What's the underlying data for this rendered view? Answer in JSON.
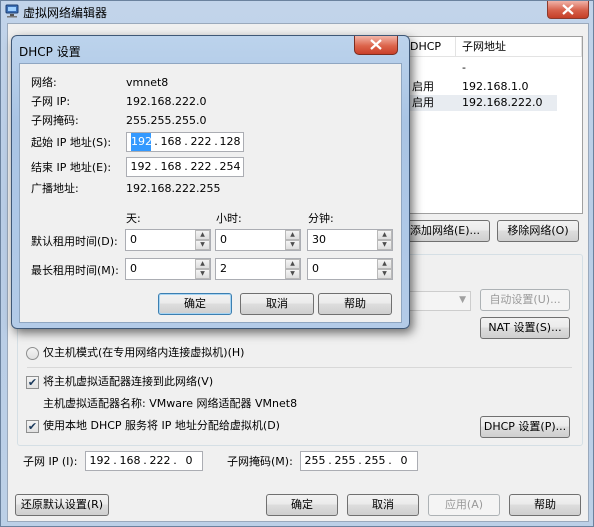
{
  "window": {
    "title": "虚拟网络编辑器"
  },
  "net_list": {
    "headers": [
      "DHCP",
      "子网地址"
    ],
    "rows": [
      {
        "dhcp": "",
        "subnet": "-"
      },
      {
        "dhcp": "启用",
        "subnet": "192.168.1.0"
      },
      {
        "dhcp": "启用",
        "subnet": "192.168.222.0"
      }
    ]
  },
  "net_buttons": {
    "add": "添加网络(E)...",
    "remove": "移除网络(O)"
  },
  "vmnet_info": {
    "auto_settings": "自动设置(U)...",
    "nat_settings": "NAT 设置(S)...",
    "host_only_radio": "仅主机模式(在专用网络内连接虚拟机)(H)",
    "connect_adapter": "将主机虚拟适配器连接到此网络(V)",
    "adapter_name": "主机虚拟适配器名称: VMware 网络适配器 VMnet8",
    "use_dhcp": "使用本地 DHCP 服务将 IP 地址分配给虚拟机(D)",
    "dhcp_settings": "DHCP 设置(P)...",
    "subnet_ip_label": "子网 IP (I):",
    "subnet_ip": [
      "192",
      "168",
      "222",
      "0"
    ],
    "subnet_mask_label": "子网掩码(M):",
    "subnet_mask": [
      "255",
      "255",
      "255",
      "0"
    ]
  },
  "bottom_buttons": {
    "restore": "还原默认设置(R)",
    "ok": "确定",
    "cancel": "取消",
    "apply": "应用(A)",
    "help": "帮助"
  },
  "dhcp_dialog": {
    "title": "DHCP 设置",
    "network_label": "网络:",
    "network_value": "vmnet8",
    "subnet_ip_label": "子网 IP:",
    "subnet_ip_value": "192.168.222.0",
    "subnet_mask_label": "子网掩码:",
    "subnet_mask_value": "255.255.255.0",
    "start_ip_label": "起始 IP 地址(S):",
    "start_ip": [
      "192",
      "168",
      "222",
      "128"
    ],
    "end_ip_label": "结束 IP 地址(E):",
    "end_ip": [
      "192",
      "168",
      "222",
      "254"
    ],
    "broadcast_label": "广播地址:",
    "broadcast_value": "192.168.222.255",
    "col_days": "天:",
    "col_hours": "小时:",
    "col_minutes": "分钟:",
    "default_lease_label": "默认租用时间(D):",
    "default_lease": {
      "days": "0",
      "hours": "0",
      "minutes": "30"
    },
    "max_lease_label": "最长租用时间(M):",
    "max_lease": {
      "days": "0",
      "hours": "2",
      "minutes": "0"
    },
    "ok": "确定",
    "cancel": "取消",
    "help": "帮助"
  }
}
